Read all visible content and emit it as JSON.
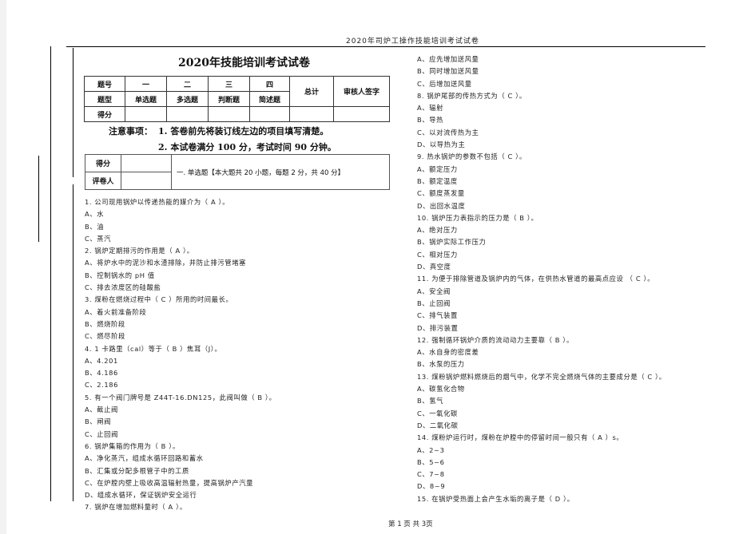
{
  "header": {
    "running_title": "2020年司炉工操作技能培训考试试卷"
  },
  "title": "2020年技能培训考试试卷",
  "score_table": {
    "row_labels": [
      "题号",
      "题型",
      "得分"
    ],
    "columns": [
      {
        "number": "一",
        "type": "单选题"
      },
      {
        "number": "二",
        "type": "多选题"
      },
      {
        "number": "三",
        "type": "判断题"
      },
      {
        "number": "四",
        "type": "简述题"
      }
    ],
    "total_label": "总计",
    "reviewer_label": "审核人签字"
  },
  "notice": {
    "label": "注意事项：",
    "items": [
      "1. 答卷前先将装订线左边的项目填写清楚。",
      "2. 本试卷满分 100 分，考试时间 90 分钟。"
    ]
  },
  "section_box": {
    "score_label": "得分",
    "grader_label": "评卷人",
    "section_title": "一. 单选题【本大题共 20 小题，每题 2 分，共 40 分】"
  },
  "left_column": [
    "1. 公司现用锅炉以传递热能的媒介为（ A ）。",
    "A、水",
    "B、油",
    "C、蒸汽",
    "2. 锅炉定期排污的作用是（ A ）。",
    "A、将炉水中的泥沙和水渣排除，并防止排污管堵塞",
    "B、控制锅水的 pH 值",
    "C、排去浓度区的硅酸盐",
    "3. 煤粉在燃烧过程中（  C ）所用的时间最长。",
    "A、着火前准备阶段",
    "B、燃烧阶段",
    "C、燃尽阶段",
    "4. 1 卡路里（cal）等于（ B ）焦耳（J）。",
    "A、4.201",
    "B、4.186",
    "C、2.186",
    "5. 有一个阀门牌号是 Z44T-16.DN125，此阀叫做（ B ）。",
    "A、截止阀",
    "B、闸阀",
    "C、止回阀",
    "6. 锅炉集箱的作用为（ B ）。",
    "A、净化蒸汽，组成水循环回路和蓄水",
    "B、汇集或分配多根管子中的工质",
    "C、在炉膛内壁上吸收高温辐射热量，提高锅炉产汽量",
    "D、组成水循环，保证锅炉安全运行",
    "7. 锅炉在增加燃料量时（ A ）。"
  ],
  "right_column": [
    "A、应先增加送风量",
    "B、同时增加送风量",
    "C、后增加送风量",
    "8. 锅炉尾部的传热方式为（ C  ）。",
    "A、辐射",
    "B、导热",
    "C、以对流传热为主",
    "D、以导热为主",
    "9. 热水锅炉的参数不包括（ C ）。",
    "A、额定压力",
    "B、额定温度",
    "C、额度蒸发量",
    "D、出回水温度",
    "10. 锅炉压力表指示的压力是（ B ）。",
    "A、绝对压力",
    "B、锅炉实际工作压力",
    "C、相对压力",
    "D、真空度",
    "11. 为便于排除管道及锅炉内的气体，在供热水管道的最高点应设 （ C ）。",
    "A、安全阀",
    "B、止回阀",
    "C、排气装置",
    "D、排污装置",
    "12. 强制循环锅炉介质的流动动力主要靠（   B   ）。",
    "A、水自身的密度差",
    "B、水泵的压力",
    "13. 煤粉锅炉燃料燃烧后的烟气中，化学不完全燃烧气体的主要成分是（ C ）。",
    "A、碳氢化合物",
    "B、氢气",
    "C、一氧化碳",
    "D、二氧化碳",
    "14. 煤粉炉运行时，煤粉在炉膛中的停留时间一般只有（ A ）s。",
    "A、2~3",
    "B、5~6",
    "C、7~8",
    "D、8~9",
    "15. 在锅炉受热面上会产生水垢的离子是（ D ）。"
  ],
  "footer": {
    "page_info": "第 1 页 共 3页"
  }
}
